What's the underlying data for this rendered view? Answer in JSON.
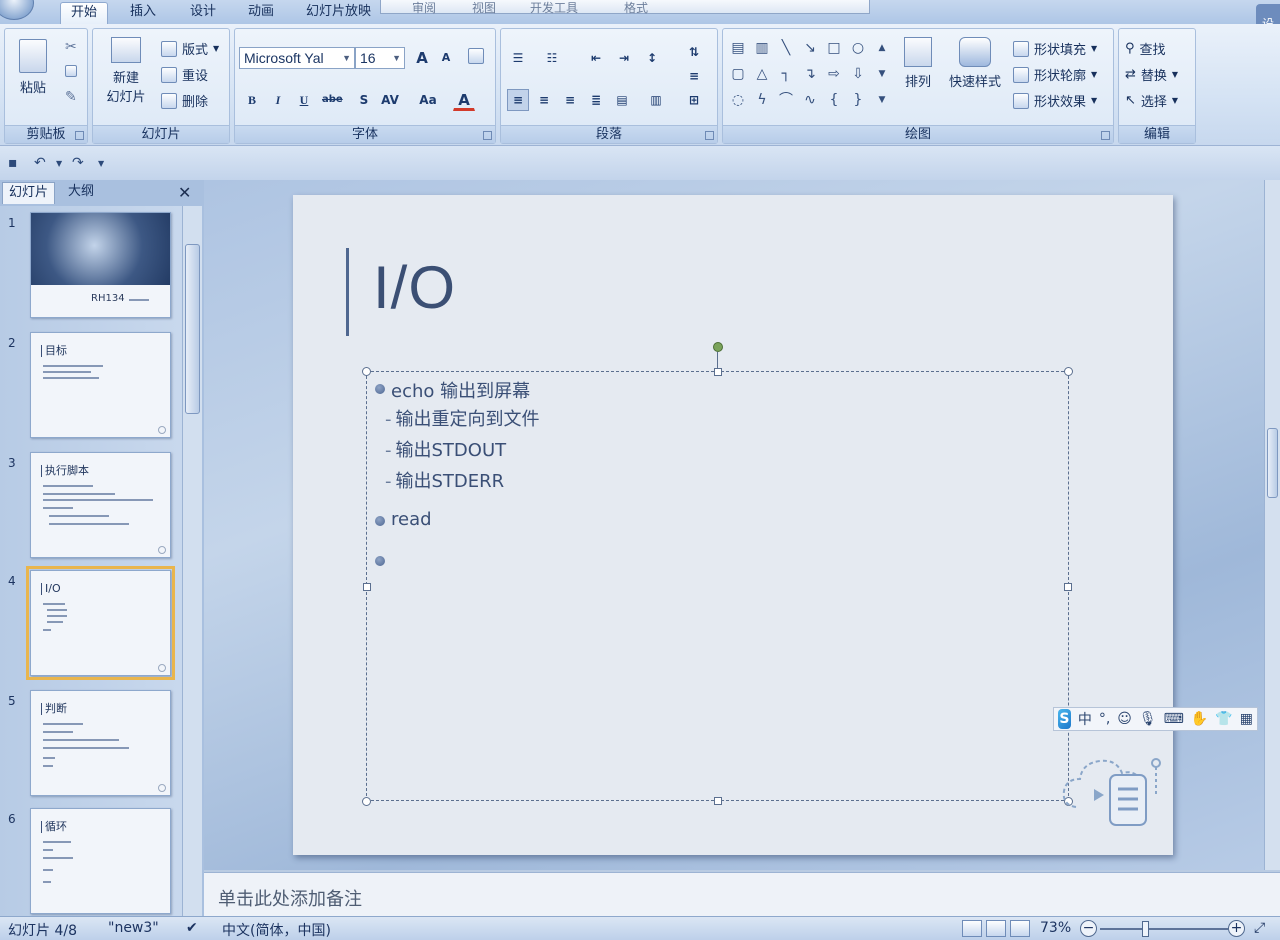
{
  "ribbon_tabs": [
    "开始",
    "插入",
    "设计",
    "动画",
    "幻灯片放映",
    "审阅",
    "视图",
    "开发工具",
    "格式"
  ],
  "active_tab": "开始",
  "help_label": "设",
  "groups": {
    "clipboard": {
      "label": "剪贴板",
      "paste": "粘贴"
    },
    "slides": {
      "label": "幻灯片",
      "new_slide_1": "新建",
      "new_slide_2": "幻灯片",
      "layout": "版式",
      "reset": "重设",
      "delete": "删除"
    },
    "font": {
      "label": "字体",
      "font_name": "Microsoft Yal",
      "font_size": "16",
      "bold": "B",
      "italic": "I",
      "underline": "U",
      "strike": "abe",
      "shadow": "S",
      "spacing": "AV",
      "case": "Aa",
      "color": "A",
      "grow": "A",
      "shrink": "A"
    },
    "paragraph": {
      "label": "段落"
    },
    "drawing": {
      "label": "绘图",
      "arrange": "排列",
      "quick_styles": "快速样式",
      "fill": "形状填充",
      "outline": "形状轮廓",
      "effects": "形状效果"
    },
    "editing": {
      "label": "编辑",
      "find": "查找",
      "replace": "替换",
      "select": "选择"
    }
  },
  "left_pane": {
    "tabs": [
      "幻灯片",
      "大纲"
    ],
    "active_tab": "幻灯片",
    "slides": [
      {
        "num": "1",
        "title": "",
        "caption": "RH134"
      },
      {
        "num": "2",
        "title": "目标"
      },
      {
        "num": "3",
        "title": "执行脚本"
      },
      {
        "num": "4",
        "title": "I/O"
      },
      {
        "num": "5",
        "title": "判断"
      },
      {
        "num": "6",
        "title": "循环"
      }
    ],
    "selected": "4"
  },
  "slide": {
    "title": "I/O",
    "bullets": [
      {
        "text": "echo  输出到屏幕",
        "subs": [
          "输出重定向到文件",
          "输出STDOUT",
          "输出STDERR"
        ]
      },
      {
        "text": "read",
        "subs": []
      },
      {
        "text": "",
        "subs": []
      }
    ]
  },
  "ime_toolbar": {
    "logo": "S",
    "mode": "中",
    "punct": "°,"
  },
  "notes_placeholder": "单击此处添加备注",
  "status": {
    "slide_counter": "幻灯片 4/8",
    "theme": "\"new3\"",
    "language": "中文(简体，中国)",
    "zoom": "73%",
    "zoom_level_pct": 73
  },
  "colors": {
    "accent": "#4f6790",
    "ribbon": "#d5e3f4",
    "slide_bg": "#e5eaf1",
    "selection": "#e9b54d"
  }
}
